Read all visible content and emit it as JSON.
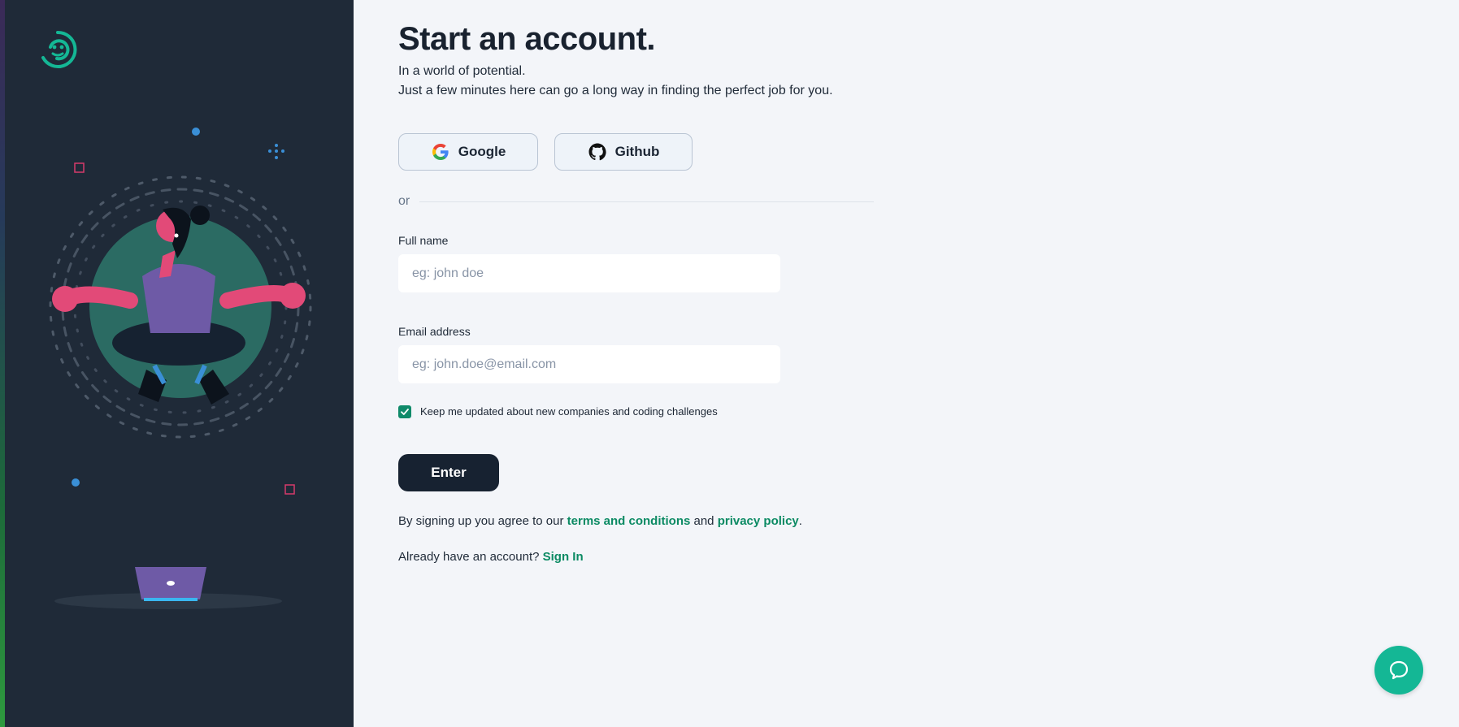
{
  "header": {
    "title": "Start an account.",
    "subtitle_line1": "In a world of potential.",
    "subtitle_line2": "Just a few minutes here can go a long way in finding the perfect job for you."
  },
  "oauth": {
    "google_label": "Google",
    "github_label": "Github"
  },
  "divider": {
    "label": "or"
  },
  "form": {
    "full_name": {
      "label": "Full name",
      "placeholder": "eg: john doe",
      "value": ""
    },
    "email": {
      "label": "Email address",
      "placeholder": "eg: john.doe@email.com",
      "value": ""
    },
    "updates_checkbox": {
      "label": "Keep me updated about new companies and coding challenges",
      "checked": true
    },
    "submit_label": "Enter"
  },
  "legal": {
    "prefix": "By signing up you agree to our ",
    "terms_link": "terms and conditions",
    "middle": " and ",
    "privacy_link": "privacy policy",
    "suffix": "."
  },
  "signin": {
    "prefix": "Already have an account? ",
    "link": "Sign In"
  },
  "icons": {
    "logo": "brand-logo-icon",
    "google": "google-icon",
    "github": "github-icon",
    "check": "check-icon",
    "chat": "chat-icon"
  },
  "colors": {
    "sidebar_bg": "#1f2a38",
    "page_bg": "#f3f5f9",
    "accent_green": "#0b8a63",
    "chat_teal": "#14b795",
    "primary_button": "#172231"
  }
}
